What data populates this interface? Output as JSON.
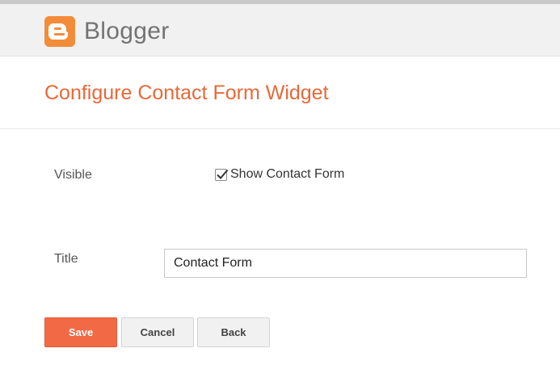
{
  "header": {
    "brand_name": "Blogger",
    "logo_icon": "blogger-logo-icon",
    "brand_color": "#f38c39"
  },
  "page": {
    "title": "Configure Contact Form Widget",
    "title_color": "#e8683a"
  },
  "form": {
    "visible_label": "Visible",
    "show_checkbox_label": "Show Contact Form",
    "show_checkbox_checked": true,
    "title_label": "Title",
    "title_value": "Contact Form"
  },
  "buttons": {
    "save_label": "Save",
    "cancel_label": "Cancel",
    "back_label": "Back",
    "save_color": "#f26a45"
  }
}
